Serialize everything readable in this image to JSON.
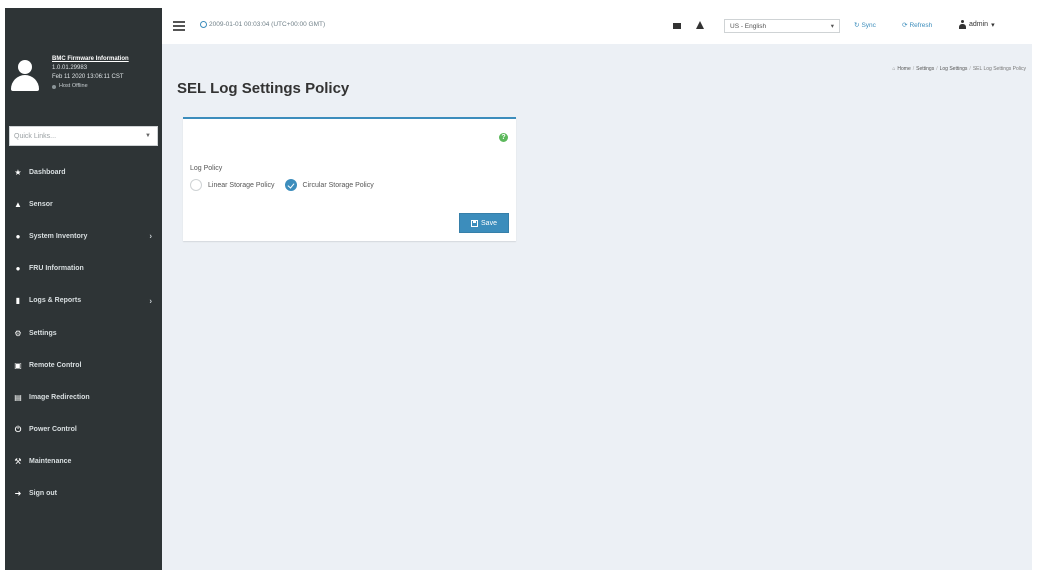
{
  "header": {
    "datetime": "2009-01-01 00:03:04 (UTC+00:00 GMT)",
    "language": "US - English",
    "sync_label": "Sync",
    "refresh_label": "Refresh",
    "user_label": "admin"
  },
  "sidebar": {
    "user": {
      "title": "BMC Firmware Information",
      "line1": "1.0.01.29983",
      "line2": "Feb 11 2020 13:06:11 CST",
      "status": "Host Offline"
    },
    "quick_links_placeholder": "Quick Links...",
    "items": [
      {
        "label": "Dashboard",
        "icon": "dashboard-icon"
      },
      {
        "label": "Sensor",
        "icon": "sensor-icon"
      },
      {
        "label": "System Inventory",
        "icon": "inventory-icon"
      },
      {
        "label": "FRU Information",
        "icon": "fru-icon"
      },
      {
        "label": "Logs & Reports",
        "icon": "bar-chart-icon"
      },
      {
        "label": "Settings",
        "icon": "gear-icon"
      },
      {
        "label": "Remote Control",
        "icon": "monitor-icon"
      },
      {
        "label": "Image Redirection",
        "icon": "image-icon"
      },
      {
        "label": "Power Control",
        "icon": "power-icon"
      },
      {
        "label": "Maintenance",
        "icon": "wrench-icon"
      },
      {
        "label": "Sign out",
        "icon": "sign-out-icon"
      }
    ]
  },
  "page": {
    "title": "SEL Log Settings Policy",
    "breadcrumb": [
      "Home",
      "Settings",
      "Log Settings",
      "SEL Log Settings Policy"
    ]
  },
  "form": {
    "field_label": "Log Policy",
    "option_linear": "Linear Storage Policy",
    "option_circular": "Circular Storage Policy",
    "selected": "Circular Storage Policy",
    "save_label": "Save"
  },
  "colors": {
    "sidebar_bg": "#2e3436",
    "accent": "#3c8dbc",
    "help": "#5cb85c",
    "content_bg": "#ecf0f5"
  }
}
